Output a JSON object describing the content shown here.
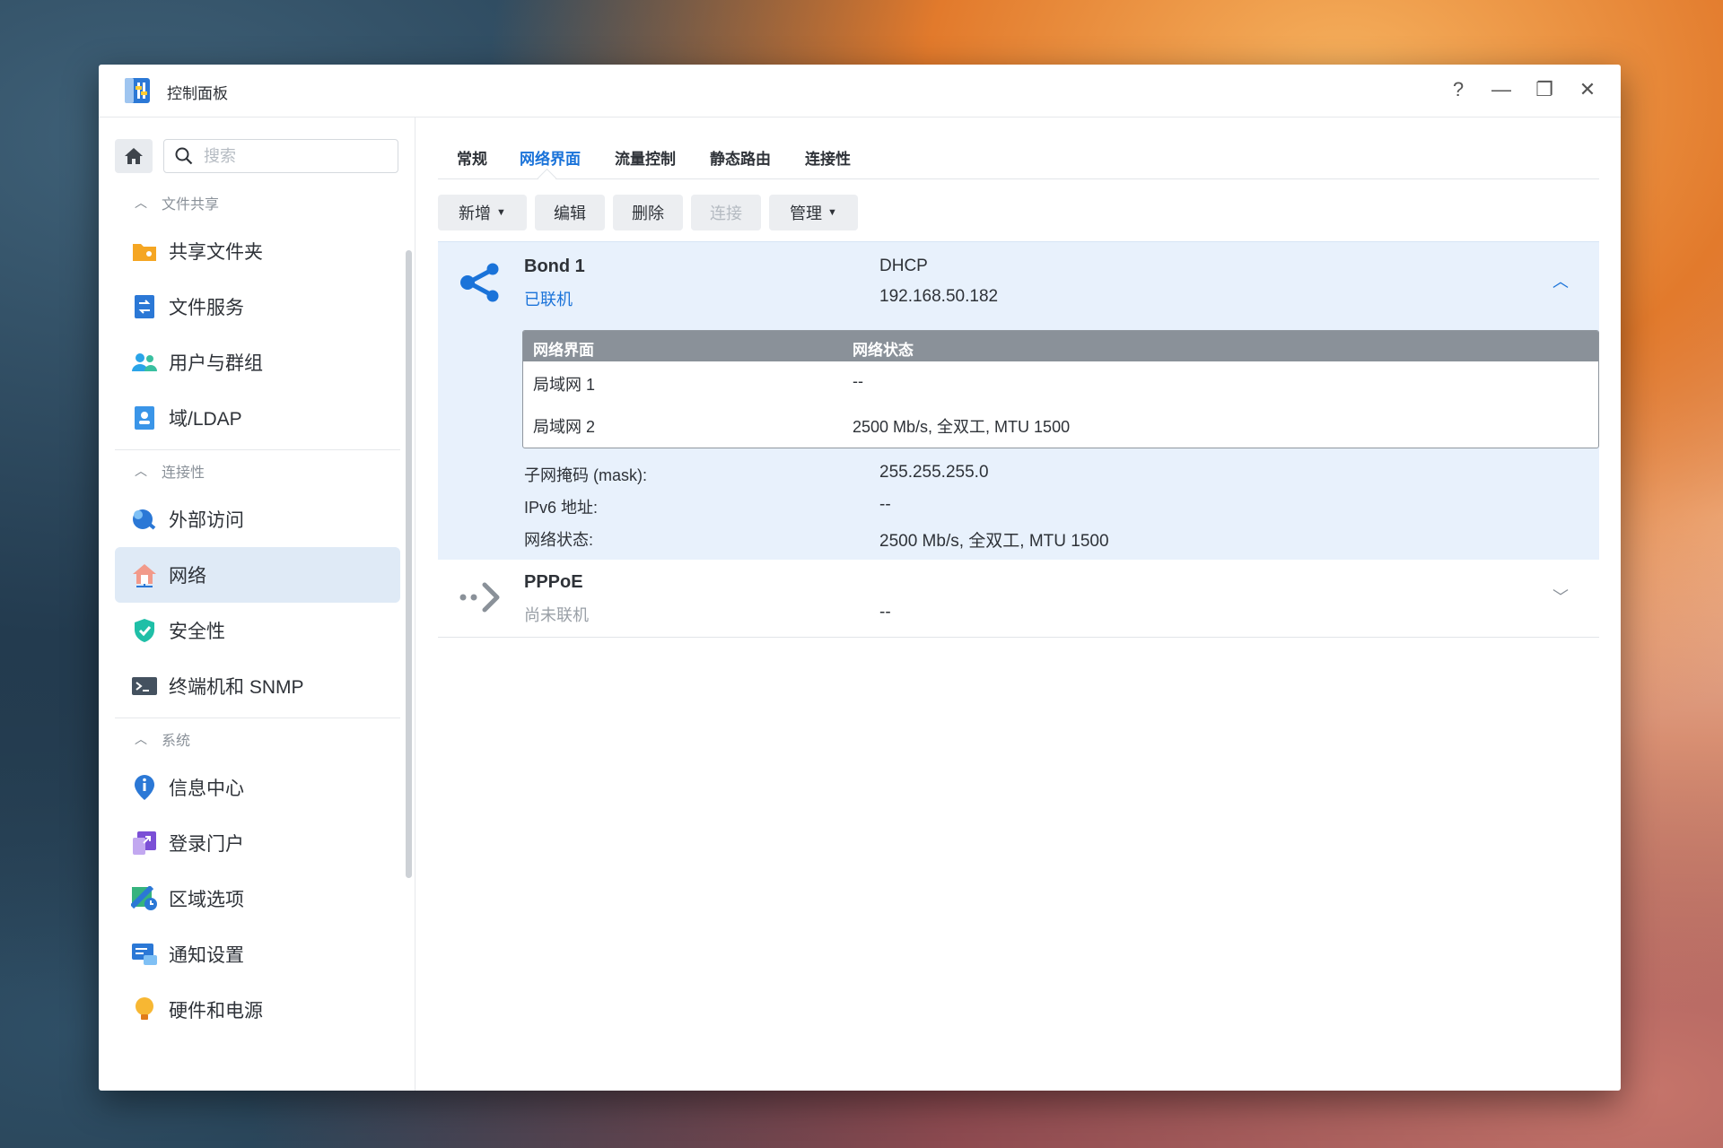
{
  "window": {
    "title": "控制面板",
    "controls": {
      "help": "?",
      "minimize": "—",
      "maximize": "❐",
      "close": "✕"
    }
  },
  "sidebar": {
    "search_placeholder": "搜索",
    "groups": [
      {
        "label": "文件共享",
        "items": [
          "共享文件夹",
          "文件服务",
          "用户与群组",
          "域/LDAP"
        ]
      },
      {
        "label": "连接性",
        "items": [
          "外部访问",
          "网络",
          "安全性",
          "终端机和 SNMP"
        ]
      },
      {
        "label": "系统",
        "items": [
          "信息中心",
          "登录门户",
          "区域选项",
          "通知设置",
          "硬件和电源"
        ]
      }
    ],
    "active_item": "网络"
  },
  "tabs": [
    "常规",
    "网络界面",
    "流量控制",
    "静态路由",
    "连接性"
  ],
  "active_tab": "网络界面",
  "toolbar": {
    "add": "新增",
    "edit": "编辑",
    "delete": "删除",
    "connect": "连接",
    "manage": "管理"
  },
  "interfaces": {
    "bond": {
      "name": "Bond 1",
      "status": "已联机",
      "mode": "DHCP",
      "ip": "192.168.50.182",
      "members_header": {
        "col1": "网络界面",
        "col2": "网络状态"
      },
      "members": [
        {
          "name": "局域网 1",
          "state": "--"
        },
        {
          "name": "局域网 2",
          "state": "2500 Mb/s, 全双工, MTU 1500"
        }
      ],
      "details": [
        {
          "label": "子网掩码 (mask):",
          "value": "255.255.255.0"
        },
        {
          "label": "IPv6 地址:",
          "value": "--"
        },
        {
          "label": "网络状态:",
          "value": "2500 Mb/s, 全双工, MTU 1500"
        }
      ]
    },
    "pppoe": {
      "name": "PPPoE",
      "status": "尚未联机",
      "value": "--"
    }
  },
  "colors": {
    "accent": "#1a73d9",
    "selected_bg": "#e8f1fc",
    "header_gray": "#8a9199"
  }
}
